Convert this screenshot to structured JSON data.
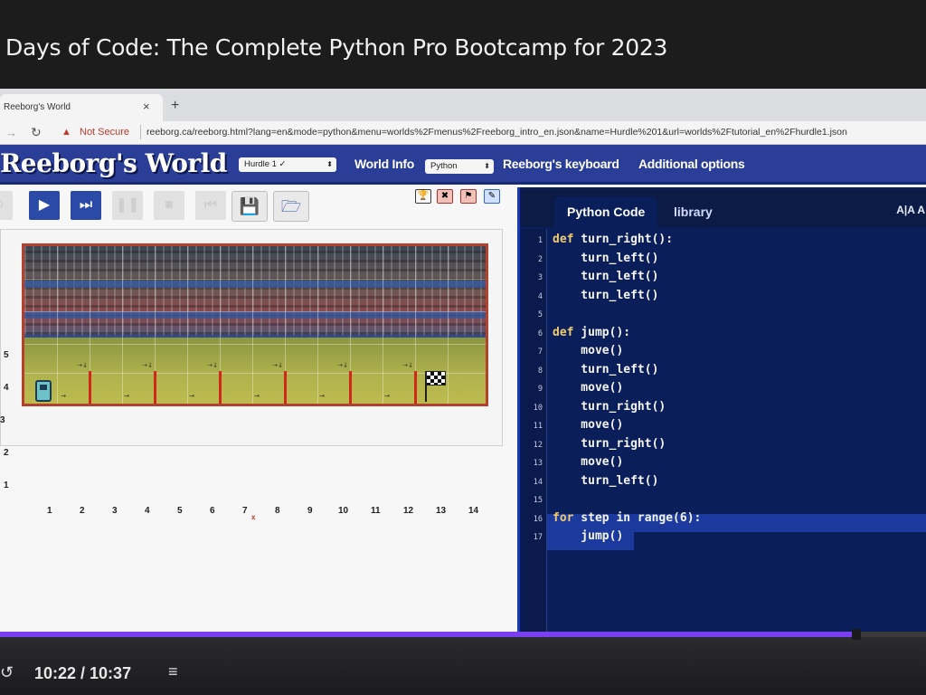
{
  "course": {
    "title": "Days of Code: The Complete Python Pro Bootcamp for 2023"
  },
  "browser": {
    "tab_title": "Reeborg's World",
    "tab_close": "×",
    "new_tab": "+",
    "security": "Not Secure",
    "url": "reeborg.ca/reeborg.html?lang=en&mode=python&menu=worlds%2Fmenus%2Freeborg_intro_en.json&name=Hurdle%201&url=worlds%2Ftutorial_en%2Fhurdle1.json"
  },
  "reeborg": {
    "logo": "Reeborg's World",
    "world_select": "Hurdle 1 ✓",
    "world_info": "World Info",
    "language_select": "Python",
    "keyboard": "Reeborg's keyboard",
    "options": "Additional options"
  },
  "world": {
    "x_labels": [
      "1",
      "2",
      "3",
      "4",
      "5",
      "6",
      "7",
      "8",
      "9",
      "10",
      "11",
      "12",
      "13",
      "14"
    ],
    "y_labels": [
      "5",
      "4",
      "3",
      "2",
      "1"
    ],
    "x_marker": "x"
  },
  "code_panel": {
    "tab_code": "Python Code",
    "tab_library": "library",
    "font_toggle": "A|A A",
    "lines": [
      {
        "n": "1",
        "kw": "def",
        "rest": " turn_right():"
      },
      {
        "n": "2",
        "kw": "",
        "rest": "    turn_left()"
      },
      {
        "n": "3",
        "kw": "",
        "rest": "    turn_left()"
      },
      {
        "n": "4",
        "kw": "",
        "rest": "    turn_left()"
      },
      {
        "n": "5",
        "kw": "",
        "rest": ""
      },
      {
        "n": "6",
        "kw": "def",
        "rest": " jump():"
      },
      {
        "n": "7",
        "kw": "",
        "rest": "    move()"
      },
      {
        "n": "8",
        "kw": "",
        "rest": "    turn_left()"
      },
      {
        "n": "9",
        "kw": "",
        "rest": "    move()"
      },
      {
        "n": "10",
        "kw": "",
        "rest": "    turn_right()"
      },
      {
        "n": "11",
        "kw": "",
        "rest": "    move()"
      },
      {
        "n": "12",
        "kw": "",
        "rest": "    turn_right()"
      },
      {
        "n": "13",
        "kw": "",
        "rest": "    move()"
      },
      {
        "n": "14",
        "kw": "",
        "rest": "    turn_left()"
      },
      {
        "n": "15",
        "kw": "",
        "rest": ""
      },
      {
        "n": "16",
        "kw": "for",
        "rest": " step in range(6):"
      },
      {
        "n": "17",
        "kw": "",
        "rest": "    jump()"
      }
    ]
  },
  "video": {
    "time": "10:22 / 10:37",
    "progress": 0.93,
    "accent": "#7a3ff0"
  }
}
